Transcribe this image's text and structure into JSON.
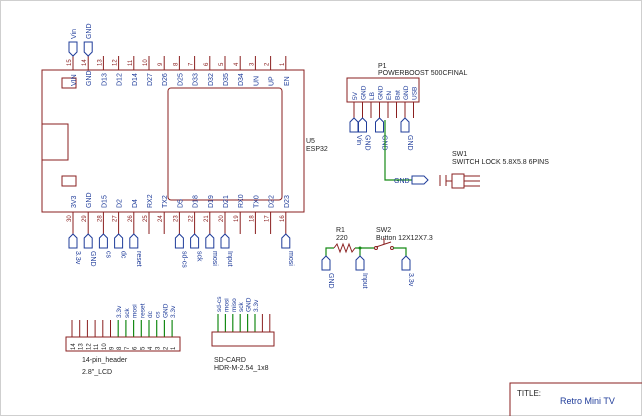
{
  "esp32": {
    "ref": "U5",
    "value": "ESP32",
    "top_pins": [
      {
        "num": "15",
        "name": "VIN"
      },
      {
        "num": "14",
        "name": "GND"
      },
      {
        "num": "13",
        "name": "D13"
      },
      {
        "num": "12",
        "name": "D12"
      },
      {
        "num": "11",
        "name": "D14"
      },
      {
        "num": "10",
        "name": "D27"
      },
      {
        "num": "9",
        "name": "D26"
      },
      {
        "num": "8",
        "name": "D25"
      },
      {
        "num": "7",
        "name": "D33"
      },
      {
        "num": "6",
        "name": "D32"
      },
      {
        "num": "5",
        "name": "D35"
      },
      {
        "num": "4",
        "name": "D34"
      },
      {
        "num": "3",
        "name": "UN"
      },
      {
        "num": "2",
        "name": "UP"
      },
      {
        "num": "1",
        "name": "EN"
      }
    ],
    "bottom_pins": [
      {
        "num": "30",
        "name": "3V3"
      },
      {
        "num": "29",
        "name": "GND"
      },
      {
        "num": "28",
        "name": "D15"
      },
      {
        "num": "27",
        "name": "D2"
      },
      {
        "num": "26",
        "name": "D4"
      },
      {
        "num": "25",
        "name": "RX2"
      },
      {
        "num": "24",
        "name": "TX2"
      },
      {
        "num": "23",
        "name": "D5"
      },
      {
        "num": "22",
        "name": "D18"
      },
      {
        "num": "21",
        "name": "D19"
      },
      {
        "num": "20",
        "name": "D21"
      },
      {
        "num": "19",
        "name": "RX0"
      },
      {
        "num": "18",
        "name": "TX0"
      },
      {
        "num": "17",
        "name": "D22"
      },
      {
        "num": "16",
        "name": "D23"
      }
    ],
    "top_flags": [
      "Vin",
      "GND"
    ],
    "bottom_flags": [
      {
        "pin": 0,
        "label": "3.3v"
      },
      {
        "pin": 1,
        "label": "GND"
      },
      {
        "pin": 2,
        "label": "cs"
      },
      {
        "pin": 3,
        "label": "dc"
      },
      {
        "pin": 4,
        "label": "reset"
      },
      {
        "pin": 7,
        "label": "sd-cs"
      },
      {
        "pin": 8,
        "label": "sck"
      },
      {
        "pin": 9,
        "label": "mosi"
      },
      {
        "pin": 10,
        "label": "Input"
      },
      {
        "pin": 14,
        "label": "mosi"
      }
    ]
  },
  "powerboost": {
    "ref": "P1",
    "value": "POWERBOOST 500CFINAL",
    "pins": [
      "5V",
      "GND",
      "LB",
      "GND",
      "EN",
      "Bat",
      "GND",
      "USB"
    ],
    "flags": [
      "Vin",
      "GND",
      "GND",
      "GND"
    ]
  },
  "switch1": {
    "ref": "SW1",
    "value": "SWITCH LOCK 5.8X5.8 6PINS",
    "flag": "GND"
  },
  "resistor": {
    "ref": "R1",
    "value": "220"
  },
  "switch2": {
    "ref": "SW2",
    "value": "Button 12X12X7.3"
  },
  "button_flags": [
    "GND",
    "Input",
    "3.3v"
  ],
  "lcd_header": {
    "name": "14-pin_header",
    "value": "2.8\"_LCD",
    "pin_numbers": [
      "14",
      "13",
      "12",
      "11",
      "10",
      "9",
      "8",
      "7",
      "6",
      "5",
      "4",
      "3",
      "2",
      "1"
    ],
    "signal_labels": [
      "3.3v",
      "sck",
      "mosi",
      "reset",
      "dc",
      "cs",
      "GND",
      "3.3v"
    ]
  },
  "sd_header": {
    "name": "SD-CARD",
    "value": "HDR-M-2.54_1x8",
    "signal_labels": [
      "sd-cs",
      "mosi",
      "miso",
      "sck",
      "GND",
      "3.3v"
    ]
  },
  "title_block": {
    "label": "TITLE:",
    "title": "Retro Mini TV"
  }
}
